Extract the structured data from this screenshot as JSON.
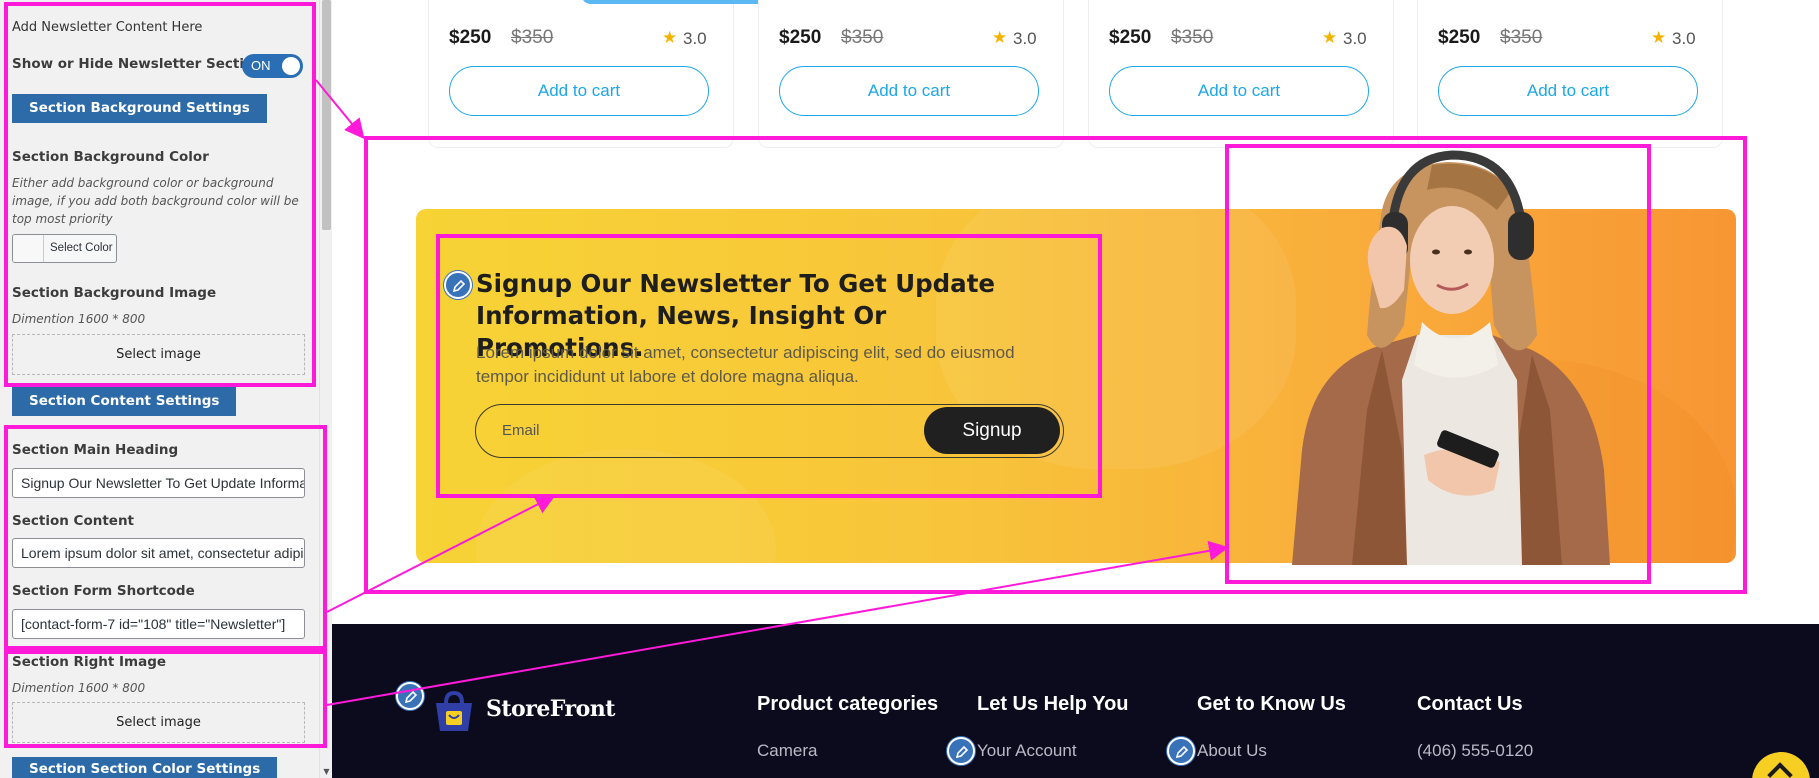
{
  "panel": {
    "add_content_text": "Add Newsletter Content Here",
    "show_hide_label": "Show or Hide Newsletter Section",
    "toggle_state": "ON",
    "bg_settings_button": "Section Background Settings",
    "bg_color_label": "Section Background Color",
    "bg_color_desc": "Either add background color or background image, if you add both background color will be top most priority",
    "select_color_label": "Select Color",
    "bg_image_label": "Section Background Image",
    "bg_image_dimension": "Dimention 1600 * 800",
    "select_image_label": "Select image",
    "content_settings_button": "Section Content Settings",
    "main_heading_label": "Section Main Heading",
    "main_heading_value": "Signup Our Newsletter To Get Update Information, News, Insight Or Promotions.",
    "content_label": "Section Content",
    "content_value": "Lorem ipsum dolor sit amet, consectetur adipiscing elit, sed do eiusmod tempor incididunt ut labore et dolore magna aliqua.",
    "shortcode_label": "Section Form Shortcode",
    "shortcode_value": "[contact-form-7 id=\"108\" title=\"Newsletter\"]",
    "right_image_label": "Section Right Image",
    "right_image_dimension": "Dimention 1600 * 800",
    "select_right_image_label": "Select image",
    "color_settings_button": "Section Section Color Settings"
  },
  "products": [
    {
      "price": "$250",
      "old_price": "$350",
      "rating": "3.0",
      "button": "Add to cart"
    },
    {
      "price": "$250",
      "old_price": "$350",
      "rating": "3.0",
      "button": "Add to cart"
    },
    {
      "price": "$250",
      "old_price": "$350",
      "rating": "3.0",
      "button": "Add to cart"
    },
    {
      "price": "$250",
      "old_price": "$350",
      "rating": "3.0",
      "button": "Add to cart"
    }
  ],
  "newsletter": {
    "heading": "Signup Our Newsletter To Get Update Information, News, Insight Or Promotions.",
    "content": "Lorem ipsum dolor sit amet, consectetur adipiscing elit, sed do eiusmod tempor incididunt ut labore et dolore magna aliqua.",
    "email_placeholder": "Email",
    "signup_button": "Signup"
  },
  "footer": {
    "logo_text": "StoreFront",
    "columns": [
      {
        "title": "Product categories",
        "first_link": "Camera"
      },
      {
        "title": "Let Us Help You",
        "first_link": "Your Account"
      },
      {
        "title": "Get to Know Us",
        "first_link": "About Us"
      },
      {
        "title": "Contact Us",
        "first_link": "(406) 555-0120"
      }
    ]
  },
  "colors": {
    "annotation": "#ff1ad9",
    "panel_button": "#2c6ba8",
    "accent_blue": "#1ea6e6",
    "footer_bg": "#0b0b1d",
    "banner_start": "#f7d335",
    "banner_end": "#f79633"
  }
}
